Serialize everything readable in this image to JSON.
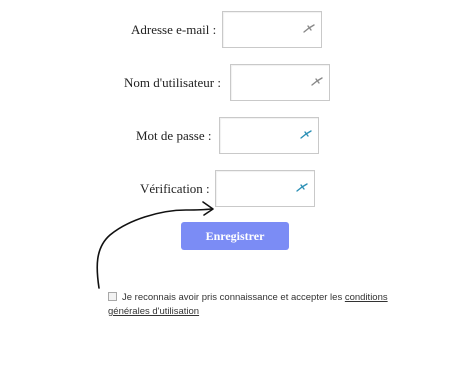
{
  "form": {
    "fields": [
      {
        "label": "Adresse e-mail :",
        "value": "",
        "icon": "pen-icon",
        "icon_color": "#888888"
      },
      {
        "label": "Nom d'utilisateur :",
        "value": "",
        "icon": "pen-icon",
        "icon_color": "#888888"
      },
      {
        "label": "Mot de passe :",
        "value": "",
        "icon": "pen-icon",
        "icon_color": "#2a8fb5"
      },
      {
        "label": "Vérification :",
        "value": "",
        "icon": "pen-icon",
        "icon_color": "#2a8fb5"
      }
    ],
    "submit_label": "Enregistrer"
  },
  "terms": {
    "text": "Je reconnais avoir pris connaissance et accepter les ",
    "link_line1": "conditions",
    "link_line2": "générales d'utilisation",
    "checked": false
  },
  "colors": {
    "button": "#7b8cf5",
    "field_border": "#c9c9c9"
  }
}
